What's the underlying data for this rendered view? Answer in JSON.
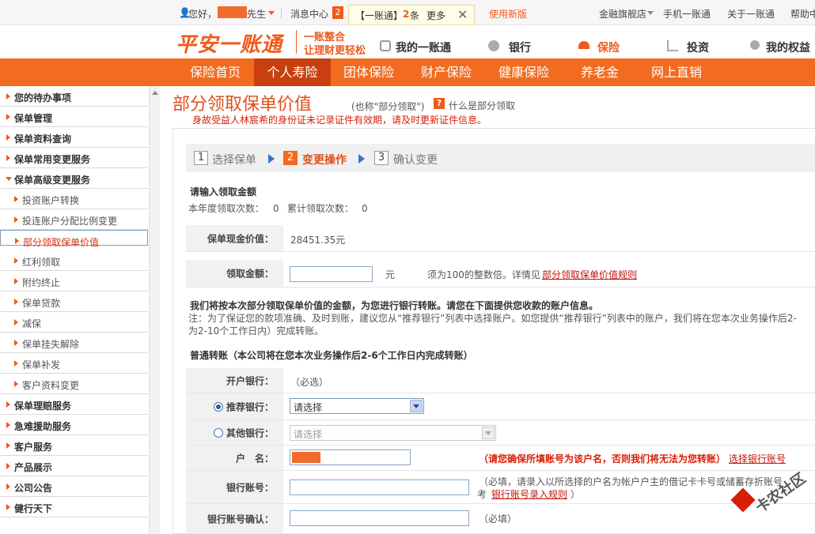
{
  "topbar": {
    "greeting": "您好，",
    "suffix": "先生",
    "messages_label": "消息中心",
    "messages_count": "2",
    "tip_prefix": "【一账通】",
    "tip_count": "2",
    "tip_suffix": "条",
    "more_label": "更多",
    "new_version": "使用新版",
    "links": [
      "金融旗舰店",
      "手机一账通",
      "关于一账通",
      "帮助中"
    ]
  },
  "brand": {
    "logo": "平安一账通",
    "slogan_1": "一账整合",
    "slogan_2": "让理财更轻松",
    "nav": [
      "我的一账通",
      "银行",
      "保险",
      "投资",
      "我的权益"
    ]
  },
  "main_nav": [
    "保险首页",
    "个人寿险",
    "团体保险",
    "财产保险",
    "健康保险",
    "养老金",
    "网上直销"
  ],
  "sidebar": {
    "items": [
      {
        "label": "您的待办事项",
        "type": "main"
      },
      {
        "label": "保单管理",
        "type": "main"
      },
      {
        "label": "保单资料查询",
        "type": "main"
      },
      {
        "label": "保单常用变更服务",
        "type": "main"
      },
      {
        "label": "保单高级变更服务",
        "type": "main-open"
      },
      {
        "label": "投资账户转换",
        "type": "sub"
      },
      {
        "label": "投连账户分配比例变更",
        "type": "sub"
      },
      {
        "label": "部分领取保单价值",
        "type": "sub-selected"
      },
      {
        "label": "红利领取",
        "type": "sub"
      },
      {
        "label": "附约终止",
        "type": "sub"
      },
      {
        "label": "保单贷款",
        "type": "sub"
      },
      {
        "label": "减保",
        "type": "sub"
      },
      {
        "label": "保单挂失解除",
        "type": "sub"
      },
      {
        "label": "保单补发",
        "type": "sub"
      },
      {
        "label": "客户资料变更",
        "type": "sub"
      },
      {
        "label": "保单理赔服务",
        "type": "main"
      },
      {
        "label": "急难援助服务",
        "type": "main"
      },
      {
        "label": "客户服务",
        "type": "main"
      },
      {
        "label": "产品展示",
        "type": "main"
      },
      {
        "label": "公司公告",
        "type": "main"
      },
      {
        "label": "健行天下",
        "type": "main"
      }
    ]
  },
  "page": {
    "title": "部分领取保单价值",
    "title_note": "(也称\"部分领取\")",
    "help_label": "什么是部分领取",
    "warning": "身故受益人林宸希的身份证未记录证件有效期，请及时更新证件信息。"
  },
  "steps": [
    {
      "num": "1",
      "label": "选择保单"
    },
    {
      "num": "2",
      "label": "变更操作"
    },
    {
      "num": "3",
      "label": "确认变更"
    }
  ],
  "form": {
    "amount_heading": "请输入领取金额",
    "year_count_label": "本年度领取次数：",
    "year_count": "0",
    "total_count_label": "累计领取次数：",
    "total_count": "0",
    "cash_value_label": "保单现金价值：",
    "cash_value": "28451.35元",
    "amount_label": "领取金额：",
    "amount_value": "",
    "amount_unit": "元",
    "amount_hint": "须为100的整数倍。详情见",
    "amount_rule_link": "部分领取保单价值规则",
    "transfer_intro": "我们将按本次部分领取保单价值的金额，为您进行银行转账。请您在下面提供您收款的账户信息。",
    "transfer_note_1": "注：为了保证您的款项准确、及时到账，建议您从“推荐银行”列表中选择账户。如您提供“推荐银行”列表中的账户，我们将在您本次业务操作后2-",
    "transfer_note_2": "为2-10个工作日内）完成转账。",
    "normal_transfer": "普通转账（本公司将在您本次业务操作后2-6个工作日内完成转账）",
    "open_bank_label": "开户银行：",
    "open_bank_req": "（必选）",
    "recommend_label": "推荐银行：",
    "recommend_select": "请选择",
    "other_label": "其他银行：",
    "other_select": "请选择",
    "name_label": "户　名：",
    "name_warning": "（请您确保所填账号为该户名，否则我们将无法为您转账）",
    "name_link": "选择银行账号",
    "account_label": "银行账号：",
    "account_value": "",
    "account_note": "（必填，请录入以所选择的户名为帐户户主的借记卡卡号或储蓄存折账号",
    "account_note_2": "考",
    "account_link": "银行账号录入规则",
    "account_note_end": "）",
    "confirm_label": "银行账号确认：",
    "confirm_value": "",
    "confirm_req": "（必填）"
  },
  "watermark": "卡农社区",
  "colors": {
    "brand_orange": "#f26b1f",
    "dark_orange": "#c8400f",
    "warning_red": "#d81e06"
  }
}
